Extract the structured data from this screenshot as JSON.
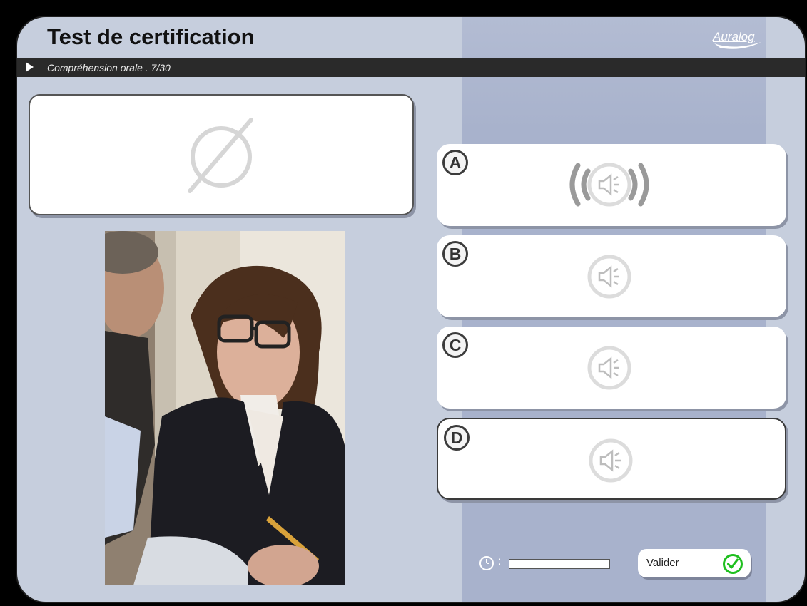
{
  "header": {
    "title": "Test de certification",
    "logo_text": "Auralog"
  },
  "breadcrumb": {
    "text": "Compréhension orale . 7/30"
  },
  "question": {
    "icon": "empty-set-icon"
  },
  "photo": {
    "subject": "business-meeting-photo"
  },
  "answers": [
    {
      "letter": "A",
      "icon": "speaker-playing-icon",
      "playing": true
    },
    {
      "letter": "B",
      "icon": "speaker-icon",
      "playing": false
    },
    {
      "letter": "C",
      "icon": "speaker-icon",
      "playing": false
    },
    {
      "letter": "D",
      "icon": "speaker-icon",
      "playing": false,
      "selected": true
    }
  ],
  "footer": {
    "timer_colon": ":",
    "timer_progress": 0,
    "validate_label": "Valider"
  },
  "colors": {
    "background": "#c6cedd",
    "panel": "#a8b2cc",
    "bar": "#2a2a2a",
    "check": "#1fbf1f"
  }
}
